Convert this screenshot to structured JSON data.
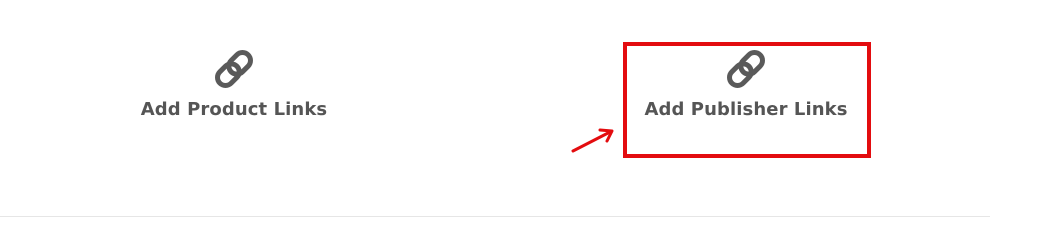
{
  "actions": {
    "product_links": {
      "label": "Add Product Links",
      "icon": "link-icon"
    },
    "publisher_links": {
      "label": "Add Publisher Links",
      "icon": "link-icon"
    }
  },
  "colors": {
    "icon": "#5a5a5a",
    "label": "#555555",
    "annotation": "#e30c0f",
    "divider": "#e6e6e6"
  }
}
